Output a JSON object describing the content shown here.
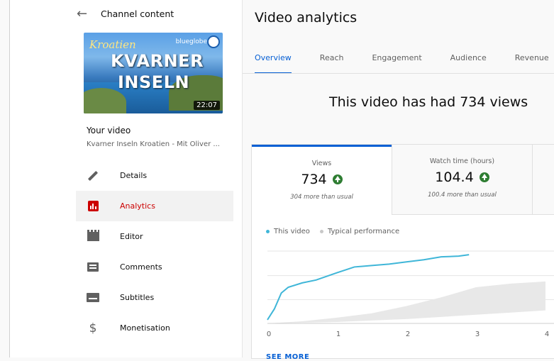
{
  "sidebar": {
    "back_title": "Channel content",
    "thumbnail": {
      "script_text": "Kroatien",
      "line1": "KVARNER",
      "line2": "INSELN",
      "brand": "blueglobe",
      "duration": "22:07"
    },
    "your_video_label": "Your video",
    "video_title": "Kvarner Inseln Kroatien - Mit Oliver ...",
    "items": [
      {
        "label": "Details",
        "icon": "pencil-icon"
      },
      {
        "label": "Analytics",
        "icon": "analytics-icon",
        "active": true
      },
      {
        "label": "Editor",
        "icon": "film-icon"
      },
      {
        "label": "Comments",
        "icon": "comments-icon"
      },
      {
        "label": "Subtitles",
        "icon": "subtitles-icon"
      },
      {
        "label": "Monetisation",
        "icon": "dollar-icon"
      }
    ]
  },
  "main": {
    "title": "Video analytics",
    "tabs": [
      {
        "label": "Overview",
        "active": true
      },
      {
        "label": "Reach"
      },
      {
        "label": "Engagement"
      },
      {
        "label": "Audience"
      },
      {
        "label": "Revenue"
      }
    ],
    "headline": "This video has had 734 views",
    "metrics": [
      {
        "label": "Views",
        "value": "734",
        "note": "304 more than usual"
      },
      {
        "label": "Watch time (hours)",
        "value": "104.4",
        "note": "100.4 more than usual"
      }
    ],
    "legend": {
      "this_video": "This video",
      "typical": "Typical performance"
    },
    "see_more": "SEE MORE"
  },
  "colors": {
    "accent": "#065fd4",
    "active_red": "#cc0000",
    "positive_green": "#2e7d32",
    "line": "#3fb6d8",
    "typical_band": "#e8e8e8"
  },
  "chart_data": {
    "type": "line",
    "x_ticks": [
      "0",
      "1",
      "2",
      "3",
      "4"
    ],
    "xlim": [
      0,
      4
    ],
    "series": [
      {
        "name": "This video",
        "x": [
          0,
          0.1,
          0.2,
          0.3,
          0.5,
          0.7,
          1.0,
          1.25,
          1.5,
          1.75,
          2.0,
          2.25,
          2.5,
          2.75,
          2.9
        ],
        "values": [
          0.05,
          0.2,
          0.42,
          0.5,
          0.56,
          0.6,
          0.7,
          0.78,
          0.8,
          0.82,
          0.85,
          0.88,
          0.92,
          0.93,
          0.95
        ]
      }
    ],
    "typical_band": {
      "x": [
        0,
        0.5,
        1.0,
        1.5,
        2.0,
        2.5,
        3.0,
        3.5,
        4.0
      ],
      "low": [
        0.0,
        0.01,
        0.02,
        0.04,
        0.06,
        0.09,
        0.12,
        0.15,
        0.18
      ],
      "high": [
        0.0,
        0.03,
        0.08,
        0.14,
        0.24,
        0.36,
        0.5,
        0.55,
        0.58
      ]
    },
    "grid": true
  }
}
